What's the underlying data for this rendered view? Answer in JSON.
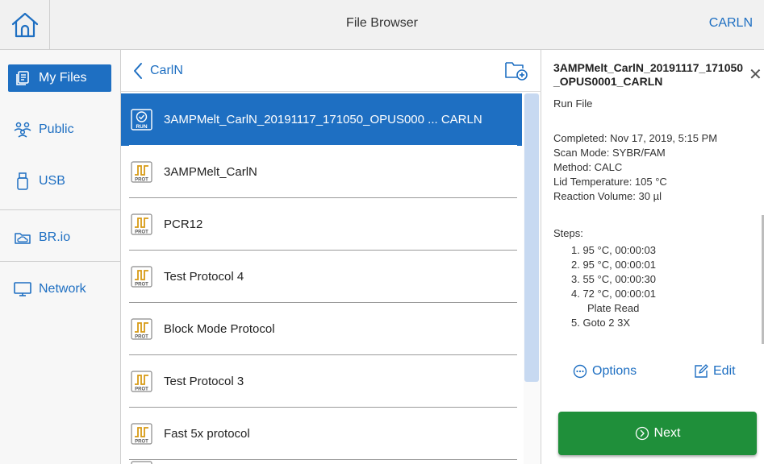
{
  "header": {
    "title": "File Browser",
    "user": "CARLN",
    "home_icon": "home-icon"
  },
  "sidebar": {
    "items": [
      {
        "label": "My Files",
        "icon": "my-files-icon",
        "active": true
      },
      {
        "label": "Public",
        "icon": "people-icon",
        "active": false
      },
      {
        "label": "USB",
        "icon": "usb-icon",
        "active": false
      },
      {
        "label": "BR.io",
        "icon": "cloud-folder-icon",
        "active": false
      },
      {
        "label": "Network",
        "icon": "monitor-icon",
        "active": false
      }
    ]
  },
  "list": {
    "folder": "CarlN",
    "new_folder_icon": "new-folder-icon",
    "files": [
      {
        "name": "3AMPMelt_CarlN_20191117_171050_OPUS000 ... CARLN",
        "type": "RUN",
        "selected": true
      },
      {
        "name": "3AMPMelt_CarlN",
        "type": "PROT",
        "selected": false
      },
      {
        "name": "PCR12",
        "type": "PROT",
        "selected": false
      },
      {
        "name": "Test Protocol 4",
        "type": "PROT",
        "selected": false
      },
      {
        "name": "Block Mode Protocol",
        "type": "PROT",
        "selected": false
      },
      {
        "name": "Test Protocol 3",
        "type": "PROT",
        "selected": false
      },
      {
        "name": "Fast 5x protocol",
        "type": "PROT",
        "selected": false
      }
    ]
  },
  "detail": {
    "title": "3AMPMelt_CarlN_20191117_171050_OPUS0001_CARLN",
    "type": "Run File",
    "completed": "Completed: Nov 17, 2019, 5:15 PM",
    "scan_mode": "Scan Mode: SYBR/FAM",
    "method": "Method: CALC",
    "lid_temp": "Lid Temperature: 105 °C",
    "reaction_volume": "Reaction Volume: 30 µl",
    "steps_label": "Steps:",
    "steps": [
      "1. 95 °C, 00:00:03",
      "2. 95 °C, 00:00:01",
      "3. 55 °C, 00:00:30",
      "4. 72 °C, 00:00:01",
      "Plate Read",
      "5. Goto 2 3X"
    ],
    "options_label": "Options",
    "edit_label": "Edit",
    "next_label": "Next"
  },
  "colors": {
    "accent": "#1e6fc2",
    "next_button": "#1f8f3a",
    "protocol_icon": "#d79a14"
  }
}
